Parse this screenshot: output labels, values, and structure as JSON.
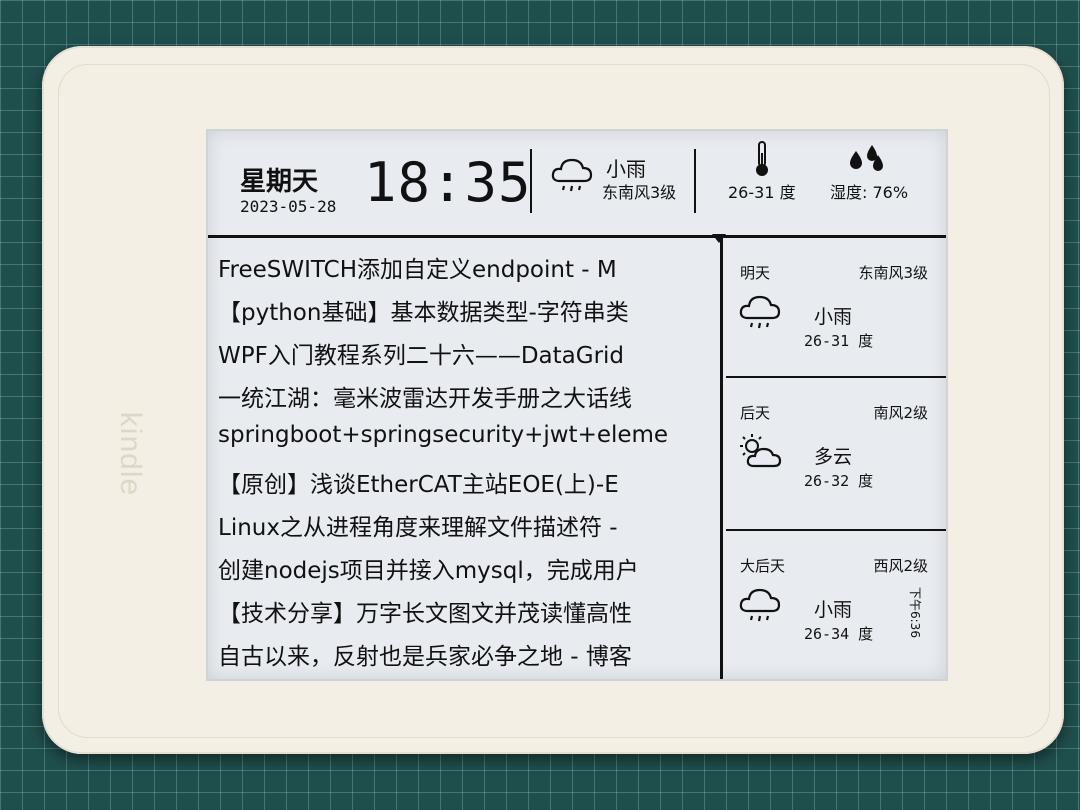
{
  "device": {
    "logo": "kindle"
  },
  "header": {
    "weekday": "星期天",
    "date": "2023-05-28",
    "time": "18:35",
    "condition": "小雨",
    "wind": "东南风3级",
    "temp_range": "26-31 度",
    "humidity": "湿度: 76%"
  },
  "news": [
    "FreeSWITCH添加自定义endpoint - M",
    "【python基础】基本数据类型-字符串类",
    "WPF入门教程系列二十六——DataGrid",
    "一统江湖：毫米波雷达开发手册之大话线",
    "springboot+springsecurity+jwt+eleme",
    "【原创】浅谈EtherCAT主站EOE(上)-E",
    "Linux之从进程角度来理解文件描述符 -",
    "创建nodejs项目并接入mysql，完成用户",
    "【技术分享】万字长文图文并茂读懂高性",
    "自古以来，反射也是兵家必争之地 - 博客"
  ],
  "forecast": [
    {
      "day": "明天",
      "wind": "东南风3级",
      "condition": "小雨",
      "temp": "26-31 度",
      "icon": "rain-cloud-icon"
    },
    {
      "day": "后天",
      "wind": "南风2级",
      "condition": "多云",
      "temp": "26-32 度",
      "icon": "sun-cloud-icon"
    },
    {
      "day": "大后天",
      "wind": "西风2级",
      "condition": "小雨",
      "temp": "26-34 度",
      "icon": "rain-cloud-icon"
    }
  ],
  "update_stamp": "下午6:36"
}
